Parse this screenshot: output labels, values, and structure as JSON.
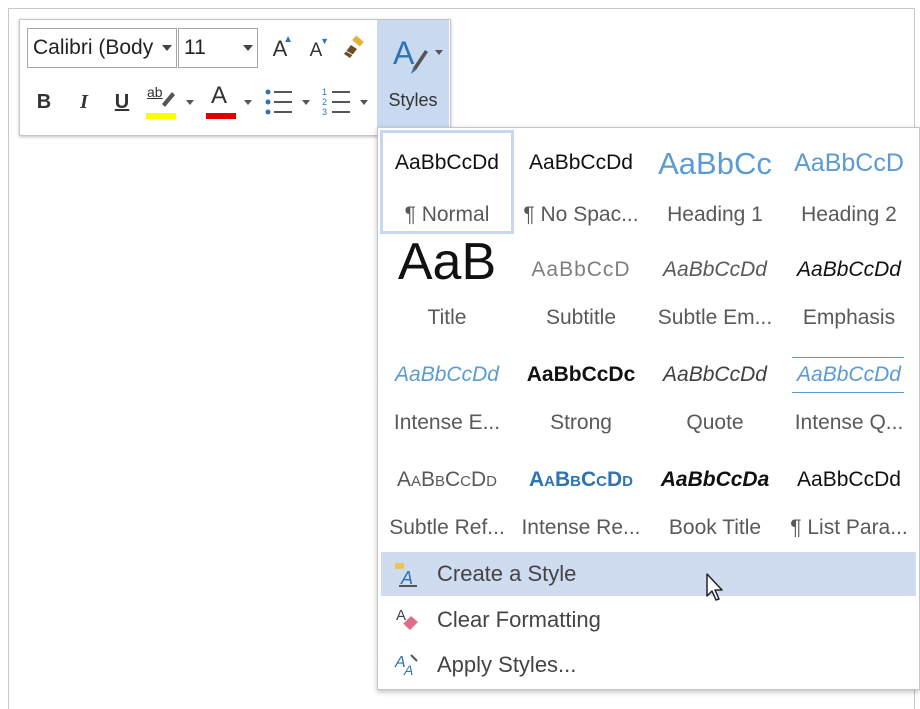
{
  "toolbar": {
    "font_name": "Calibri (Body)",
    "font_size": "11",
    "grow_font": "A",
    "shrink_font": "A",
    "bold": "B",
    "italic": "I",
    "underline": "U",
    "highlight_text": "ab",
    "highlight_color": "#ffff00",
    "font_color_letter": "A",
    "font_color": "#e00000",
    "styles_label": "Styles"
  },
  "gallery": {
    "rows": [
      [
        {
          "preview": "AaBbCcDd",
          "label": "¶ Normal",
          "selected": true
        },
        {
          "preview": "AaBbCcDd",
          "label": "¶ No Spac..."
        },
        {
          "preview": "AaBbCc",
          "label": "Heading 1"
        },
        {
          "preview": "AaBbCcD",
          "label": "Heading 2"
        }
      ],
      [
        {
          "preview": "AaB",
          "label": "Title"
        },
        {
          "preview": "AaBbCcD",
          "label": "Subtitle"
        },
        {
          "preview": "AaBbCcDd",
          "label": "Subtle Em..."
        },
        {
          "preview": "AaBbCcDd",
          "label": "Emphasis"
        }
      ],
      [
        {
          "preview": "AaBbCcDd",
          "label": "Intense E..."
        },
        {
          "preview": "AaBbCcDc",
          "label": "Strong"
        },
        {
          "preview": "AaBbCcDd",
          "label": "Quote"
        },
        {
          "preview": "AaBbCcDd",
          "label": "Intense Q..."
        }
      ],
      [
        {
          "preview": "AaBbCcDd",
          "label": "Subtle Ref..."
        },
        {
          "preview": "AaBbCcDd",
          "label": "Intense Re..."
        },
        {
          "preview": "AaBbCcDa",
          "label": "Book Title"
        },
        {
          "preview": "AaBbCcDd",
          "label": "¶ List Para..."
        }
      ]
    ]
  },
  "menu": {
    "create_style": "Create a Style",
    "clear_formatting": "Clear Formatting",
    "apply_styles": "Apply Styles..."
  },
  "colors": {
    "accent_blue": "#2e74b5",
    "heading_blue": "#5b9bd5",
    "hover_bg": "#cfdcf0"
  }
}
